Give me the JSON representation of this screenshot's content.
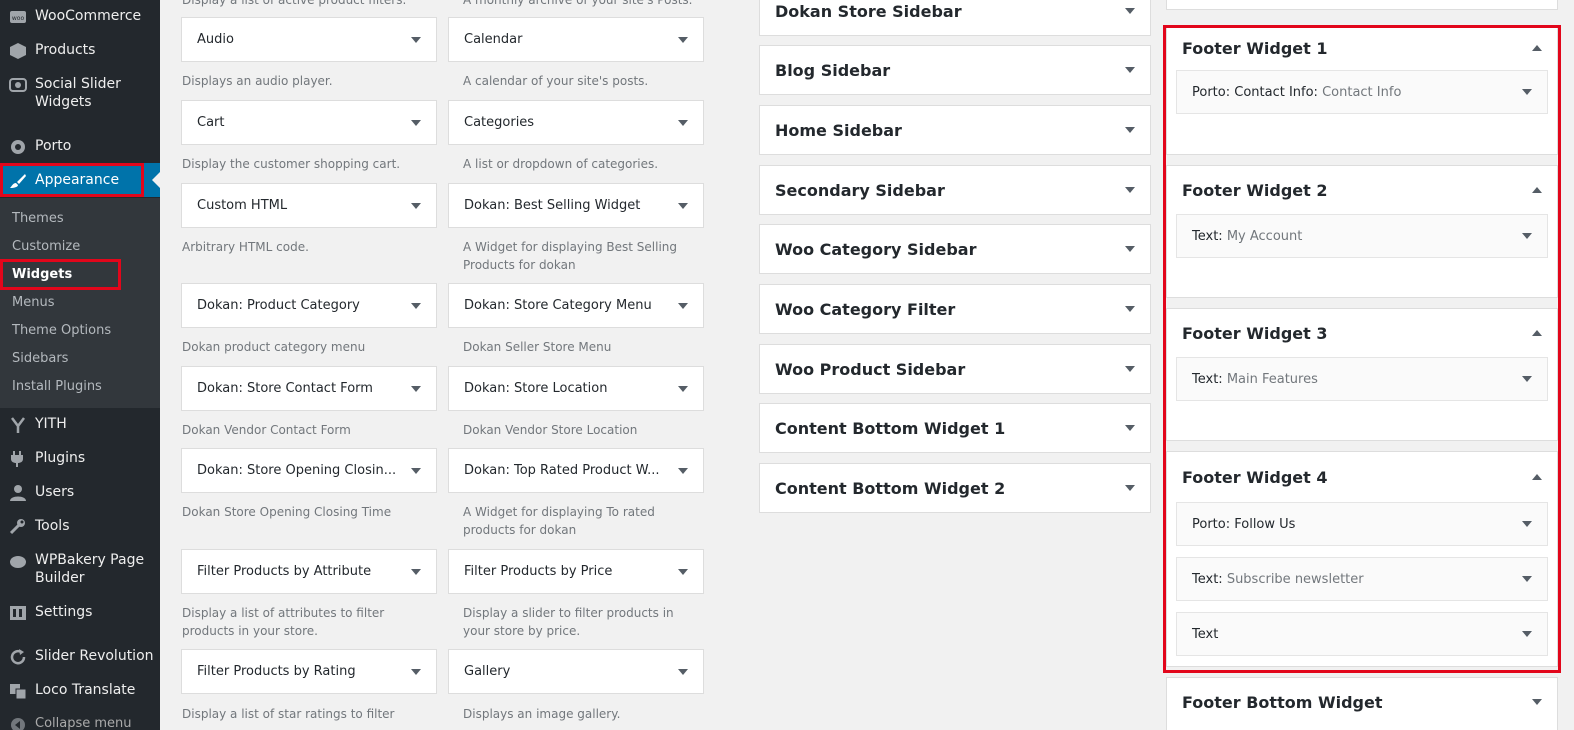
{
  "admin_menu": {
    "woocommerce": "WooCommerce",
    "products": "Products",
    "social_slider": "Social Slider Widgets",
    "porto": "Porto",
    "appearance": "Appearance",
    "yith": "YITH",
    "plugins": "Plugins",
    "users": "Users",
    "tools": "Tools",
    "wpbakery": "WPBakery Page Builder",
    "settings": "Settings",
    "slider_revolution": "Slider Revolution",
    "loco_translate": "Loco Translate",
    "collapse": "Collapse menu"
  },
  "appearance_submenu": {
    "themes": "Themes",
    "customize": "Customize",
    "widgets": "Widgets",
    "menus": "Menus",
    "theme_options": "Theme Options",
    "sidebars": "Sidebars",
    "install_plugins": "Install Plugins"
  },
  "available_widgets": {
    "top_left_desc": "Display a list of active product filters.",
    "top_right_desc": "A monthly archive of your site's Posts.",
    "items": [
      {
        "title": "Audio",
        "desc": "Displays an audio player."
      },
      {
        "title": "Calendar",
        "desc": "A calendar of your site's posts."
      },
      {
        "title": "Cart",
        "desc": "Display the customer shopping cart."
      },
      {
        "title": "Categories",
        "desc": "A list or dropdown of categories."
      },
      {
        "title": "Custom HTML",
        "desc": "Arbitrary HTML code."
      },
      {
        "title": "Dokan: Best Selling Widget",
        "desc": "A Widget for displaying Best Selling Products for dokan"
      },
      {
        "title": "Dokan: Product Category",
        "desc": "Dokan product category menu"
      },
      {
        "title": "Dokan: Store Category Menu",
        "desc": "Dokan Seller Store Menu"
      },
      {
        "title": "Dokan: Store Contact Form",
        "desc": "Dokan Vendor Contact Form"
      },
      {
        "title": "Dokan: Store Location",
        "desc": "Dokan Vendor Store Location"
      },
      {
        "title": "Dokan: Store Opening Closin...",
        "desc": "Dokan Store Opening Closing Time"
      },
      {
        "title": "Dokan: Top Rated Product W...",
        "desc": "A Widget for displaying To rated products for dokan"
      },
      {
        "title": "Filter Products by Attribute",
        "desc": "Display a list of attributes to filter products in your store."
      },
      {
        "title": "Filter Products by Price",
        "desc": "Display a slider to filter products in your store by price."
      },
      {
        "title": "Filter Products by Rating",
        "desc": "Display a list of star ratings to filter"
      },
      {
        "title": "Gallery",
        "desc": "Displays an image gallery."
      }
    ]
  },
  "sidebars": [
    "Dokan Store Sidebar",
    "Blog Sidebar",
    "Home Sidebar",
    "Secondary Sidebar",
    "Woo Category Sidebar",
    "Woo Category Filter",
    "Woo Product Sidebar",
    "Content Bottom Widget 1",
    "Content Bottom Widget 2"
  ],
  "footer_widgets": [
    {
      "title": "Footer Widget 1",
      "widgets": [
        {
          "type": "Porto: Contact Info:",
          "name": "Contact Info"
        }
      ]
    },
    {
      "title": "Footer Widget 2",
      "widgets": [
        {
          "type": "Text:",
          "name": "My Account"
        }
      ]
    },
    {
      "title": "Footer Widget 3",
      "widgets": [
        {
          "type": "Text:",
          "name": "Main Features"
        }
      ]
    },
    {
      "title": "Footer Widget 4",
      "widgets": [
        {
          "type": "Porto: Follow Us",
          "name": ""
        },
        {
          "type": "Text:",
          "name": "Subscribe newsletter"
        },
        {
          "type": "Text",
          "name": ""
        }
      ]
    }
  ],
  "footer_bottom": "Footer Bottom Widget",
  "colors": {
    "admin_bg": "#23282d",
    "submenu_bg": "#32373c",
    "active_blue": "#0073aa",
    "highlight_red": "#e2061b",
    "page_bg": "#f1f1f1"
  }
}
